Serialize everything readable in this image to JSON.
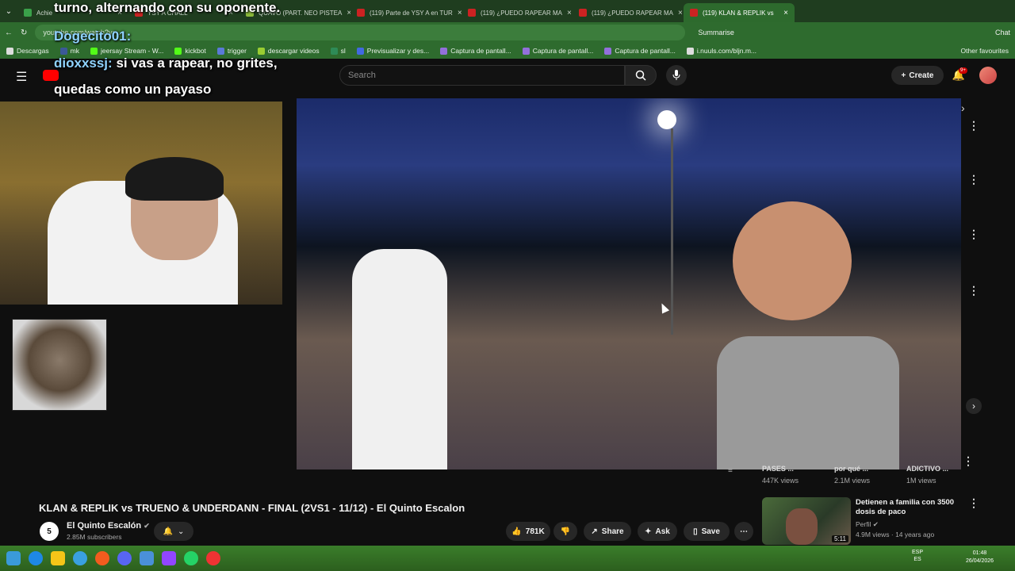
{
  "browser": {
    "tabs": [
      {
        "label": "Achie",
        "color": "#3aa14a",
        "active": false
      },
      {
        "label": "YSY A CHALL",
        "color": "#cc2222",
        "active": false
      },
      {
        "label": "QUAVO (PART. NEO PISTEA",
        "color": "#8ab83a",
        "active": false
      },
      {
        "label": "(119) Parte de YSY A en TUR",
        "color": "#cc2222",
        "active": false
      },
      {
        "label": "(119) ¿PUEDO RAPEAR MA",
        "color": "#cc2222",
        "active": false
      },
      {
        "label": "(119) ¿PUEDO RAPEAR MA",
        "color": "#cc2222",
        "active": false
      },
      {
        "label": "(119) KLAN & REPLIK vs",
        "color": "#cc2222",
        "active": true
      }
    ],
    "url": "youtube.com/watch?v=...",
    "summarise_label": "Summarise",
    "chat_label": "Chat",
    "bookmarks": [
      {
        "label": "Descargas",
        "color": "#ddd"
      },
      {
        "label": "mk",
        "color": "#3b5998"
      },
      {
        "label": "jeersay Stream - W...",
        "color": "#53fc18"
      },
      {
        "label": "kickbot",
        "color": "#53fc18"
      },
      {
        "label": "trigger",
        "color": "#5a7ad8"
      },
      {
        "label": "descargar videos",
        "color": "#9acd32"
      },
      {
        "label": "sl",
        "color": "#2e8b57"
      },
      {
        "label": "Previsualizar y des...",
        "color": "#4169e1"
      },
      {
        "label": "Captura de pantall...",
        "color": "#9370db"
      },
      {
        "label": "Captura de pantall...",
        "color": "#9370db"
      },
      {
        "label": "Captura de pantall...",
        "color": "#9370db"
      },
      {
        "label": "i.nuuls.com/bljn.m...",
        "color": "#ddd"
      }
    ],
    "other_bookmarks": "Other favourites"
  },
  "overlay": {
    "line1": "turno, alternando con su oponente.",
    "user1": "Dogecito01:",
    "user2": "dioxxssj:",
    "msg2": "si vas a rapear, no grites,",
    "msg2b": "quedas como un payaso"
  },
  "youtube": {
    "search_placeholder": "Search",
    "create_label": "Create",
    "bell_badge": "9+",
    "video_title": "KLAN & REPLIK vs TRUENO & UNDERDANN - FINAL (2VS1 - 11/12) - El Quinto Escalon",
    "channel_name": "El Quinto Escalón",
    "channel_subs": "2.85M subscribers",
    "likes": "781K",
    "share_label": "Share",
    "ask_label": "Ask",
    "save_label": "Save",
    "shelf": [
      {
        "title": "PASES ...",
        "views": "447K views"
      },
      {
        "title": "por qué ...",
        "views": "2.1M views"
      },
      {
        "title": "ADICTIVO ...",
        "views": "1M views"
      }
    ],
    "suggestion": {
      "title": "Detienen a familia con 3500 dosis de paco",
      "channel": "Perfil",
      "meta": "4.9M views · 14 years ago",
      "duration": "5:11"
    }
  },
  "taskbar": {
    "lang": "ESP",
    "lang2": "ES",
    "time": "01:48",
    "date": "26/04/2026"
  }
}
